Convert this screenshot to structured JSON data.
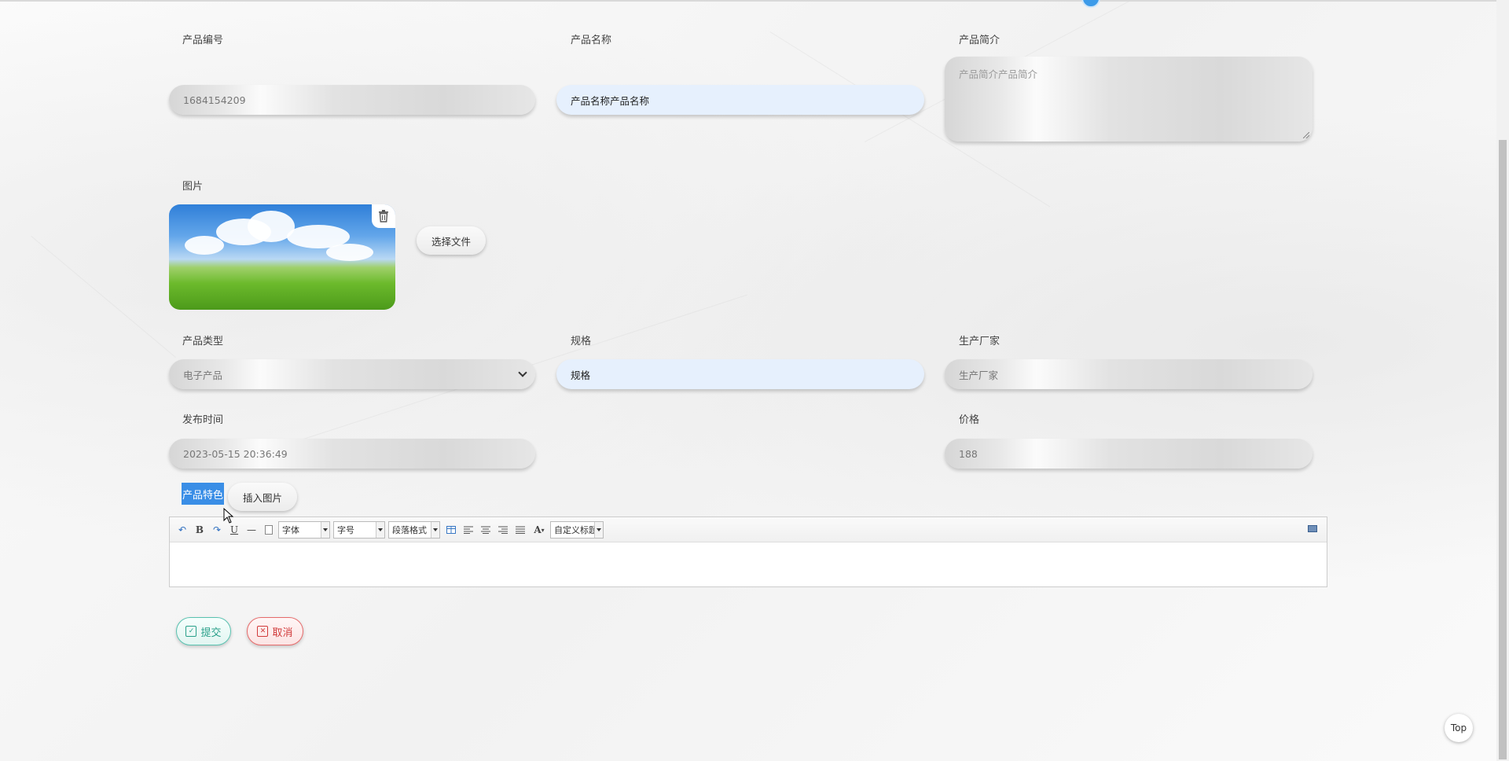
{
  "form": {
    "product_no": {
      "label": "产品编号",
      "value": "1684154209"
    },
    "product_name": {
      "label": "产品名称",
      "value": "产品名称产品名称"
    },
    "product_intro": {
      "label": "产品简介",
      "placeholder": "产品简介产品简介"
    },
    "image": {
      "label": "图片",
      "choose_file_label": "选择文件",
      "delete_icon": "trash-icon"
    },
    "product_type": {
      "label": "产品类型",
      "value": "电子产品"
    },
    "spec": {
      "label": "规格",
      "value": "规格"
    },
    "manufacturer": {
      "label": "生产厂家",
      "placeholder": "生产厂家"
    },
    "publish_time": {
      "label": "发布时间",
      "value": "2023-05-15 20:36:49"
    },
    "price": {
      "label": "价格",
      "value": "188"
    },
    "features": {
      "label": "产品特色",
      "insert_image_label": "插入图片"
    }
  },
  "editor_toolbar": {
    "font_family": "字体",
    "font_size": "字号",
    "paragraph_format": "段落格式",
    "custom_heading": "自定义标题",
    "icons": [
      "undo-icon",
      "bold-icon",
      "redo-icon",
      "underline-icon",
      "horizontal-rule-icon",
      "paste-icon",
      "table-icon",
      "align-left-icon",
      "align-center-icon",
      "align-right-icon",
      "justify-icon",
      "font-color-icon",
      "fullscreen-icon"
    ]
  },
  "actions": {
    "submit_label": "提交",
    "cancel_label": "取消"
  },
  "top_button_label": "Top",
  "colors": {
    "accent_blue": "#3a8ee6",
    "submit_green": "#2aa08a",
    "cancel_red": "#d13a3a",
    "input_blue_bg": "#e6f0fd"
  }
}
